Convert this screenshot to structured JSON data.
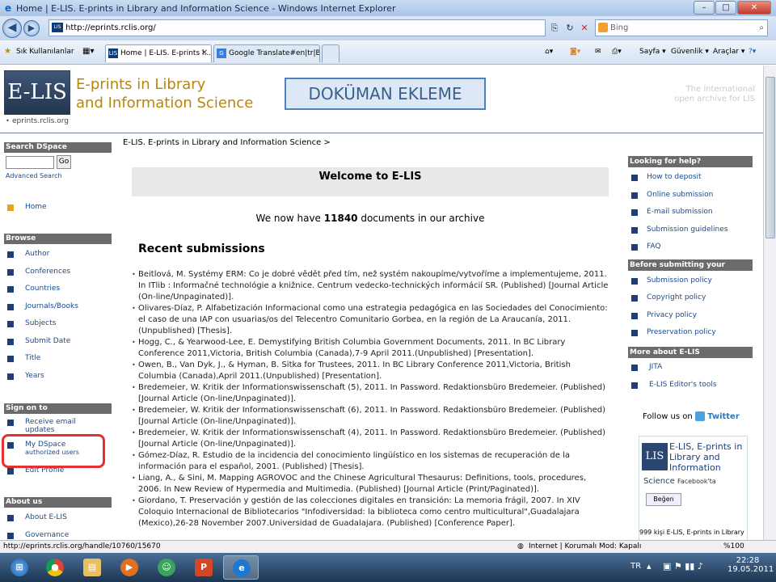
{
  "window": {
    "title": "Home | E-LIS. E-prints in Library and Information Science - Windows Internet Explorer"
  },
  "address": {
    "url": "http://eprints.rclis.org/",
    "search_placeholder": "Bing"
  },
  "favorites": {
    "label": "Sık Kullanılanlar"
  },
  "tabs": [
    {
      "label": "Home | E-LIS. E-prints i..."
    },
    {
      "label": "Google Translate#en|tr|Bo..."
    }
  ],
  "commands": {
    "page": "Sayfa ▾",
    "security": "Güvenlik ▾",
    "tools": "Araçlar ▾"
  },
  "site": {
    "name_line1": "E-prints in Library",
    "name_line2": "and Information Science",
    "logo_text": "E-LIS",
    "logo_sub": "eprints.rclis.org",
    "intl_line1": "The international",
    "intl_line2": "open archive for LIS",
    "overlay": "DOKÜMAN EKLEME",
    "breadcrumb": "E-LIS. E-prints in Library and Information Science >"
  },
  "left": {
    "search_head": "Search DSpace",
    "go": "Go",
    "advanced": "Advanced Search",
    "home": "Home",
    "browse_head": "Browse",
    "browse": [
      "Author",
      "Conferences",
      "Countries",
      "Journals/Books",
      "Subjects",
      "Submit Date",
      "Title",
      "Years"
    ],
    "signon_head": "Sign on to",
    "receive_1": "Receive email",
    "receive_2": "updates",
    "mydspace_1": "My DSpace",
    "mydspace_2": "authorized users",
    "edit_profile": "Edit Profile",
    "about_head": "About us",
    "about": "About E-LIS",
    "governance": "Governance"
  },
  "main": {
    "welcome": "Welcome to E-LIS",
    "count_pre": "We now have",
    "count": "11840",
    "count_post": "documents in our archive",
    "recent_head": "Recent submissions",
    "submissions": [
      "Beitlová, M. Systémy ERM: Co je dobré vědět před tím, než systém nakoupíme/vytvoříme a implementujeme, 2011. In ITlib : Informačné technológie a knižnice. Centrum vedecko-technických informácií SR. (Published) [Journal Article (On-line/Unpaginated)].",
      "Olivares-Díaz, P. Alfabetización Informacional como una estrategia pedagógica en las Sociedades del Conocimiento: el caso de una IAP con usuarias/os del Telecentro Comunitario Gorbea, en la región de La Araucanía, 2011. (Unpublished) [Thesis].",
      "Hogg, C., & Yearwood-Lee, E. Demystifying British Columbia Government Documents, 2011. In BC Library Conference 2011,Victoria, British Columbia (Canada),7-9 April 2011.(Unpublished) [Presentation].",
      "Owen, B., Van Dyk, J., & Hyman, B. Sitka for Trustees, 2011. In BC Library Conference 2011,Victoria, British Columbia (Canada),April 2011.(Unpublished) [Presentation].",
      "Bredemeier, W. Kritik der Informationswissenschaft (5), 2011. In Password. Redaktionsbüro Bredemeier. (Published) [Journal Article (On-line/Unpaginated)].",
      "Bredemeier, W. Kritik der Informationswissenschaft (6), 2011. In Password. Redaktionsbüro Bredemeier. (Published) [Journal Article (On-line/Unpaginated)].",
      "Bredemeier, W. Kritik der Informationswissenschaft (4), 2011. In Password. Redaktionsbüro Bredemeier. (Published) [Journal Article (On-line/Unpaginated)].",
      "Gómez-Díaz, R. Estudio de la incidencia del conocimiento lingüístico en los sistemas de recuperación de la información para el español, 2001. (Published) [Thesis].",
      "Liang, A., & Sini, M. Mapping AGROVOC and the Chinese Agricultural Thesaurus: Definitions, tools, procedures, 2006. In New Review of Hypermedia and Multimedia. (Published) [Journal Article (Print/Paginated)].",
      "Giordano, T. Preservación y gestión de las colecciones digitales en transición: La memoria frágil, 2007. In XIV Coloquio Internacional de Bibliotecarios \"Infodiversidad: la biblioteca como centro multicultural\",Guadalajara (Mexico),26-28 November 2007.Universidad de Guadalajara. (Published) [Conference Paper]."
    ]
  },
  "right": {
    "help_head": "Looking for help?",
    "help": [
      "How to deposit",
      "Online submission",
      "E-mail submission",
      "Submission guidelines",
      "FAQ"
    ],
    "before_head": "Before submitting your papers",
    "before": [
      "Submission policy",
      "Copyright policy",
      "Privacy policy",
      "Preservation policy"
    ],
    "more_head": "More about E-LIS",
    "more": [
      "JITA",
      "E-LIS Editor's tools"
    ],
    "follow": "Follow us on",
    "twitter": "Twitter",
    "fb_name": "E-LIS, E-prints in Library and Information",
    "fb_sci": "Science",
    "fb_sub": "Facebook'ta",
    "fb_like": "Beğen",
    "fb_fans": "999 kişi E-LIS, E-prints in Library"
  },
  "status": {
    "url": "http://eprints.rclis.org/handle/10760/15670",
    "zone": "Internet | Korumalı Mod: Kapalı",
    "zoom": "%100"
  },
  "taskbar": {
    "lang": "TR",
    "time": "22:28",
    "date": "19.05.2011"
  }
}
